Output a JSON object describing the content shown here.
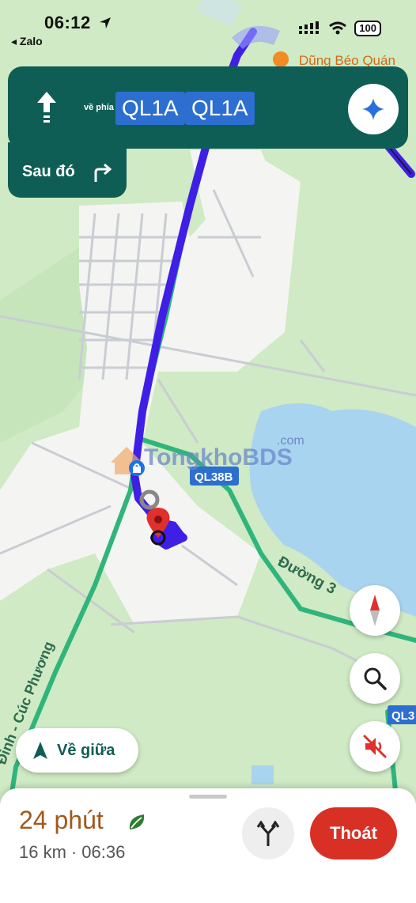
{
  "status_bar": {
    "time": "06:12",
    "back_app": "◂ Zalo",
    "battery": "100"
  },
  "navigation": {
    "toward_label": "về phía",
    "roads": [
      "QL1A",
      "QL1A"
    ],
    "then_label": "Sau đó"
  },
  "map": {
    "poi_top": "Dũng Béo Quán",
    "badge_ql38b": "QL38B",
    "badge_ql3": "QL3",
    "road_duong": "Đường 3",
    "road_cuc_phuong": "Đinh - Cúc Phương",
    "watermark_main": "TongkhoBDS",
    "watermark_sub": ".com",
    "route_color": "#3f1fe6",
    "water_color": "#a9d4f0"
  },
  "buttons": {
    "recenter": "Về giữa"
  },
  "trip": {
    "duration": "24 phút",
    "distance": "16 km",
    "separator": "·",
    "arrival": "06:36",
    "exit_label": "Thoát"
  }
}
